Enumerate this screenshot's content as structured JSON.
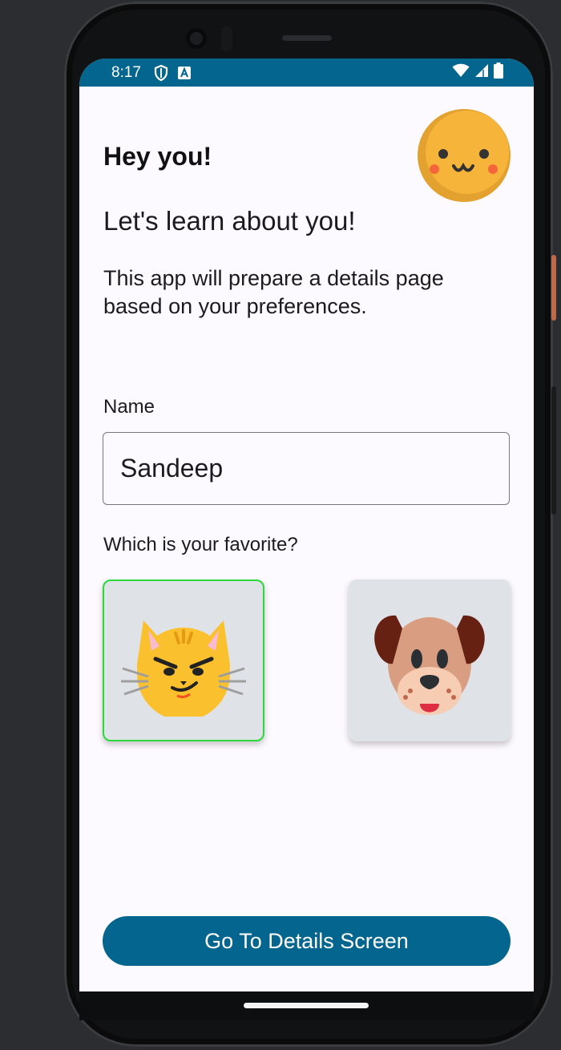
{
  "status_bar": {
    "time": "8:17",
    "icons": [
      "shield-icon",
      "a-notification-icon",
      "wifi-icon",
      "signal-icon",
      "battery-icon"
    ]
  },
  "header": {
    "greeting": "Hey you!",
    "avatar_icon": "smiling-face-icon"
  },
  "intro": {
    "title": "Let's learn about you!",
    "description": "This app will prepare a details page based on your preferences."
  },
  "form": {
    "name_label": "Name",
    "name_value": "Sandeep",
    "favorite_label": "Which is your favorite?",
    "options": [
      {
        "icon": "cat-face-icon",
        "selected": true
      },
      {
        "icon": "dog-face-icon",
        "selected": false
      }
    ]
  },
  "actions": {
    "details_button_label": "Go To Details Screen"
  },
  "colors": {
    "primary": "#04658f",
    "selected_border": "#2bd93a",
    "card_background": "#dfe3e7",
    "screen_background": "#fcf9ff"
  }
}
